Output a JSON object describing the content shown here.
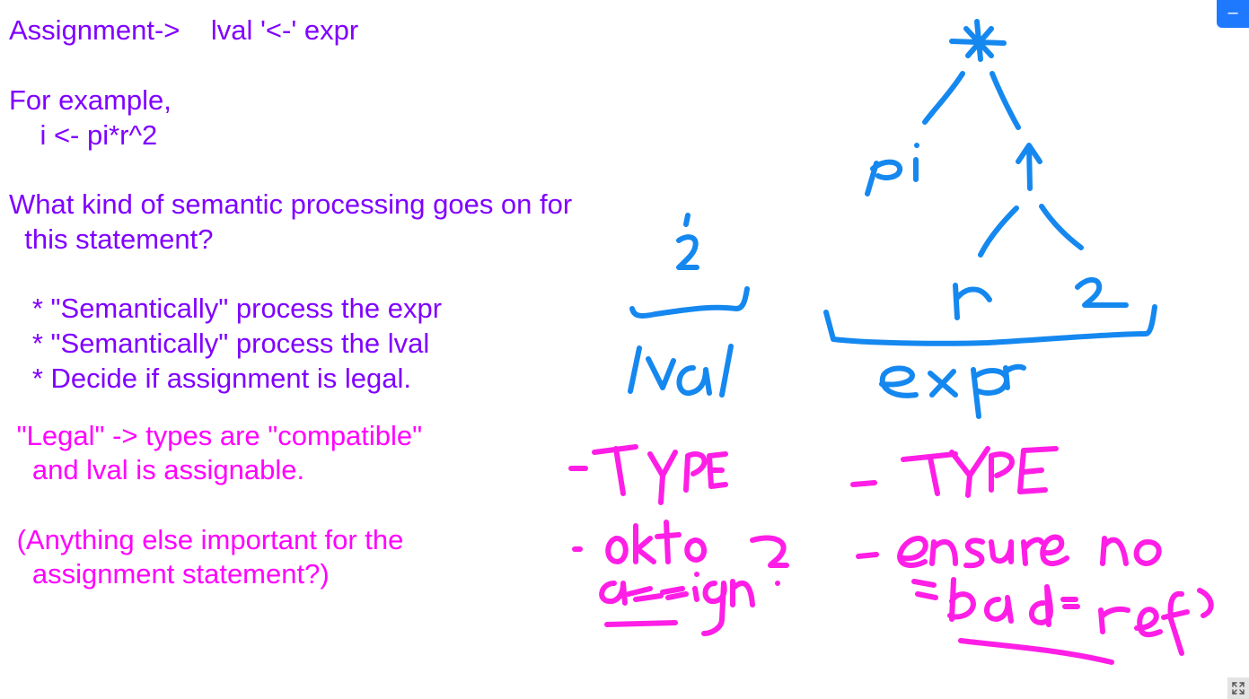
{
  "document": {
    "lines": [
      {
        "text": "Assignment->    lval '<-' expr",
        "color": "#8000ff"
      },
      {
        "text": "For example,",
        "color": "#8000ff"
      },
      {
        "text": "    i <- pi*r^2",
        "color": "#8000ff"
      },
      {
        "text": "What kind of semantic processing goes on for",
        "color": "#8000ff"
      },
      {
        "text": "  this statement?",
        "color": "#8000ff"
      },
      {
        "text": "   * \"Semantically\" process the expr",
        "color": "#8000ff"
      },
      {
        "text": "   * \"Semantically\" process the lval",
        "color": "#8000ff"
      },
      {
        "text": "   * Decide if assignment is legal.",
        "color": "#8000ff"
      },
      {
        "text": " \"Legal\" -> types are \"compatible\"",
        "color": "#ff00ff"
      },
      {
        "text": "   and lval is assignable.",
        "color": "#ff00ff"
      },
      {
        "text": " (Anything else important for the",
        "color": "#ff00ff"
      },
      {
        "text": "   assignment statement?)",
        "color": "#ff00ff"
      }
    ]
  },
  "colors": {
    "purple_text": "#8000ff",
    "magenta_text": "#ff00ff",
    "ink_blue": "#1588f0",
    "ink_magenta": "#ff1ee6",
    "control_blue": "#1e79ff"
  },
  "controls": {
    "minimize_glyph": "–",
    "minimize_icon": "minimize-icon",
    "fullscreen_icon": "fullscreen-icon"
  },
  "handwriting": {
    "tree": [
      "*",
      "pi",
      "^",
      "r",
      "2"
    ],
    "labels": [
      "i",
      "lval",
      "expr"
    ],
    "notes_left": [
      "-TYPE",
      "- ok to",
      "assign?"
    ],
    "notes_right": [
      "- TYPE",
      "- ensure no",
      "bad refs"
    ]
  }
}
